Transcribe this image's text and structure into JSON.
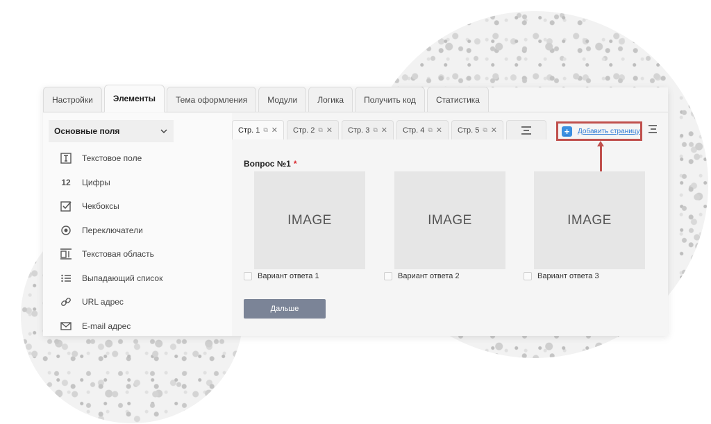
{
  "top_tabs": [
    {
      "label": "Настройки"
    },
    {
      "label": "Элементы",
      "active": true
    },
    {
      "label": "Тема оформления"
    },
    {
      "label": "Модули"
    },
    {
      "label": "Логика"
    },
    {
      "label": "Получить код"
    },
    {
      "label": "Статистика"
    }
  ],
  "sidebar": {
    "header": "Основные поля",
    "items": [
      {
        "label": "Текстовое поле",
        "icon": "text-field-icon"
      },
      {
        "label": "Цифры",
        "icon": "numbers-icon",
        "glyph": "12"
      },
      {
        "label": "Чекбоксы",
        "icon": "checkbox-icon"
      },
      {
        "label": "Переключатели",
        "icon": "radio-icon"
      },
      {
        "label": "Текстовая область",
        "icon": "textarea-icon"
      },
      {
        "label": "Выпадающий список",
        "icon": "list-icon"
      },
      {
        "label": "URL адрес",
        "icon": "link-icon"
      },
      {
        "label": "E-mail адрес",
        "icon": "mail-icon"
      }
    ]
  },
  "page_tabs": [
    {
      "label": "Стр. 1",
      "active": true
    },
    {
      "label": "Стр. 2"
    },
    {
      "label": "Стр. 3"
    },
    {
      "label": "Стр. 4"
    },
    {
      "label": "Стр. 5"
    }
  ],
  "add_page_label": "Добавить страницу",
  "question": {
    "label": "Вопрос №1",
    "required_mark": "*"
  },
  "options": [
    {
      "image_text": "IMAGE",
      "label": "Вариант ответа 1"
    },
    {
      "image_text": "IMAGE",
      "label": "Вариант ответа 2"
    },
    {
      "image_text": "IMAGE",
      "label": "Вариант ответа 3"
    }
  ],
  "next_button": "Дальше",
  "colors": {
    "highlight": "#c0504d",
    "link": "#2e7cd6",
    "required": "#d9252a",
    "button": "#7b8497"
  }
}
